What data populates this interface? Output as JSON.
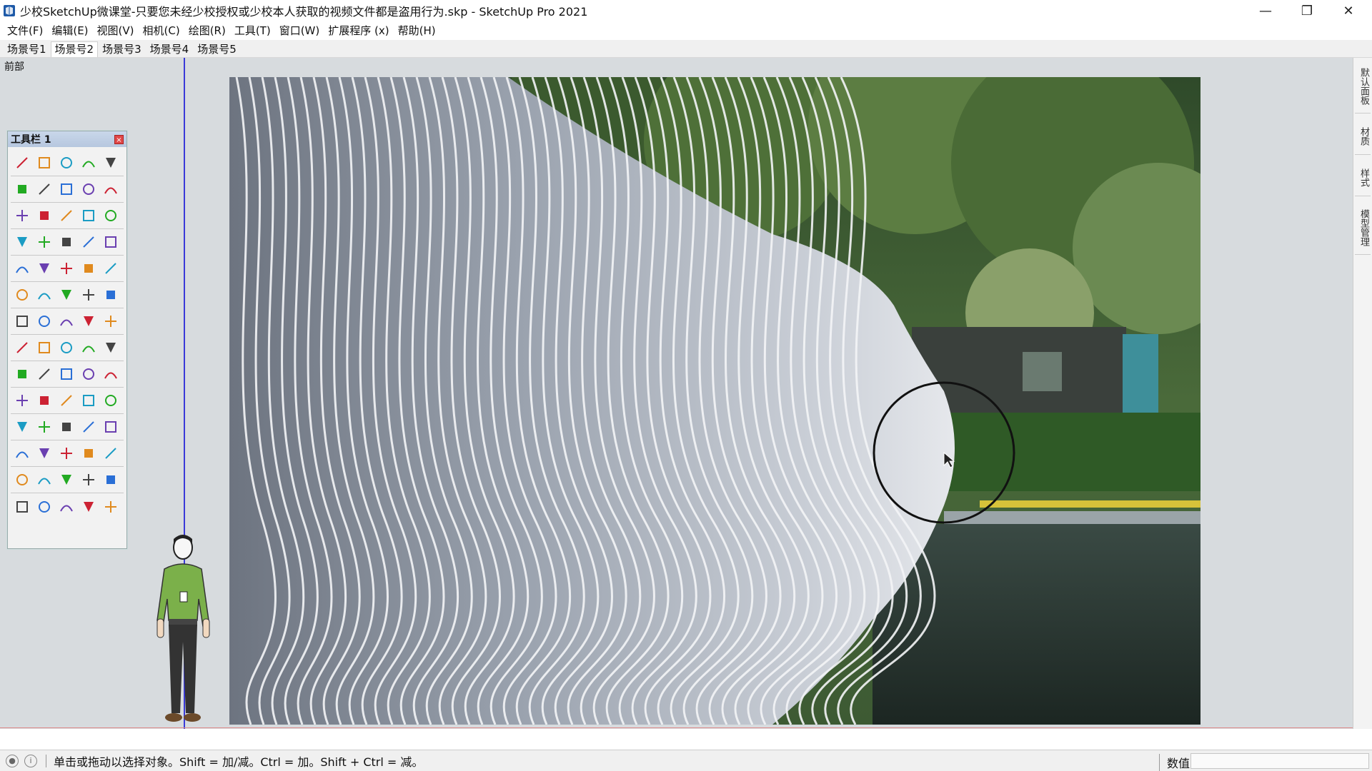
{
  "window": {
    "title": "少校SketchUp微课堂-只要您未经少校授权或少校本人获取的视频文件都是盗用行为.skp - SketchUp Pro 2021",
    "controls": {
      "minimize": "—",
      "restore": "❐",
      "close": "✕"
    }
  },
  "menubar": {
    "items": [
      "文件(F)",
      "编辑(E)",
      "视图(V)",
      "相机(C)",
      "绘图(R)",
      "工具(T)",
      "窗口(W)",
      "扩展程序 (x)",
      "帮助(H)"
    ]
  },
  "scenes": {
    "tabs": [
      "场景号1",
      "场景号2",
      "场景号3",
      "场景号4",
      "场景号5"
    ],
    "active_index": 1
  },
  "viewport": {
    "view_name": "前部",
    "background_color": "#d7dbde"
  },
  "toolbar": {
    "title": "工具栏 1",
    "close_label": "×"
  },
  "right_panel": {
    "tabs": [
      "默认面板",
      "材质",
      "样式",
      "模型管理"
    ]
  },
  "statusbar": {
    "hint": "单击或拖动以选择对象。Shift = 加/减。Ctrl = 加。Shift + Ctrl = 减。",
    "measurements_label": "数值",
    "measurements_value": ""
  },
  "colors": {
    "axis_blue": "#3a3ad8",
    "axis_red": "#dd8888",
    "toolbar_header": "#c0d0e6"
  }
}
